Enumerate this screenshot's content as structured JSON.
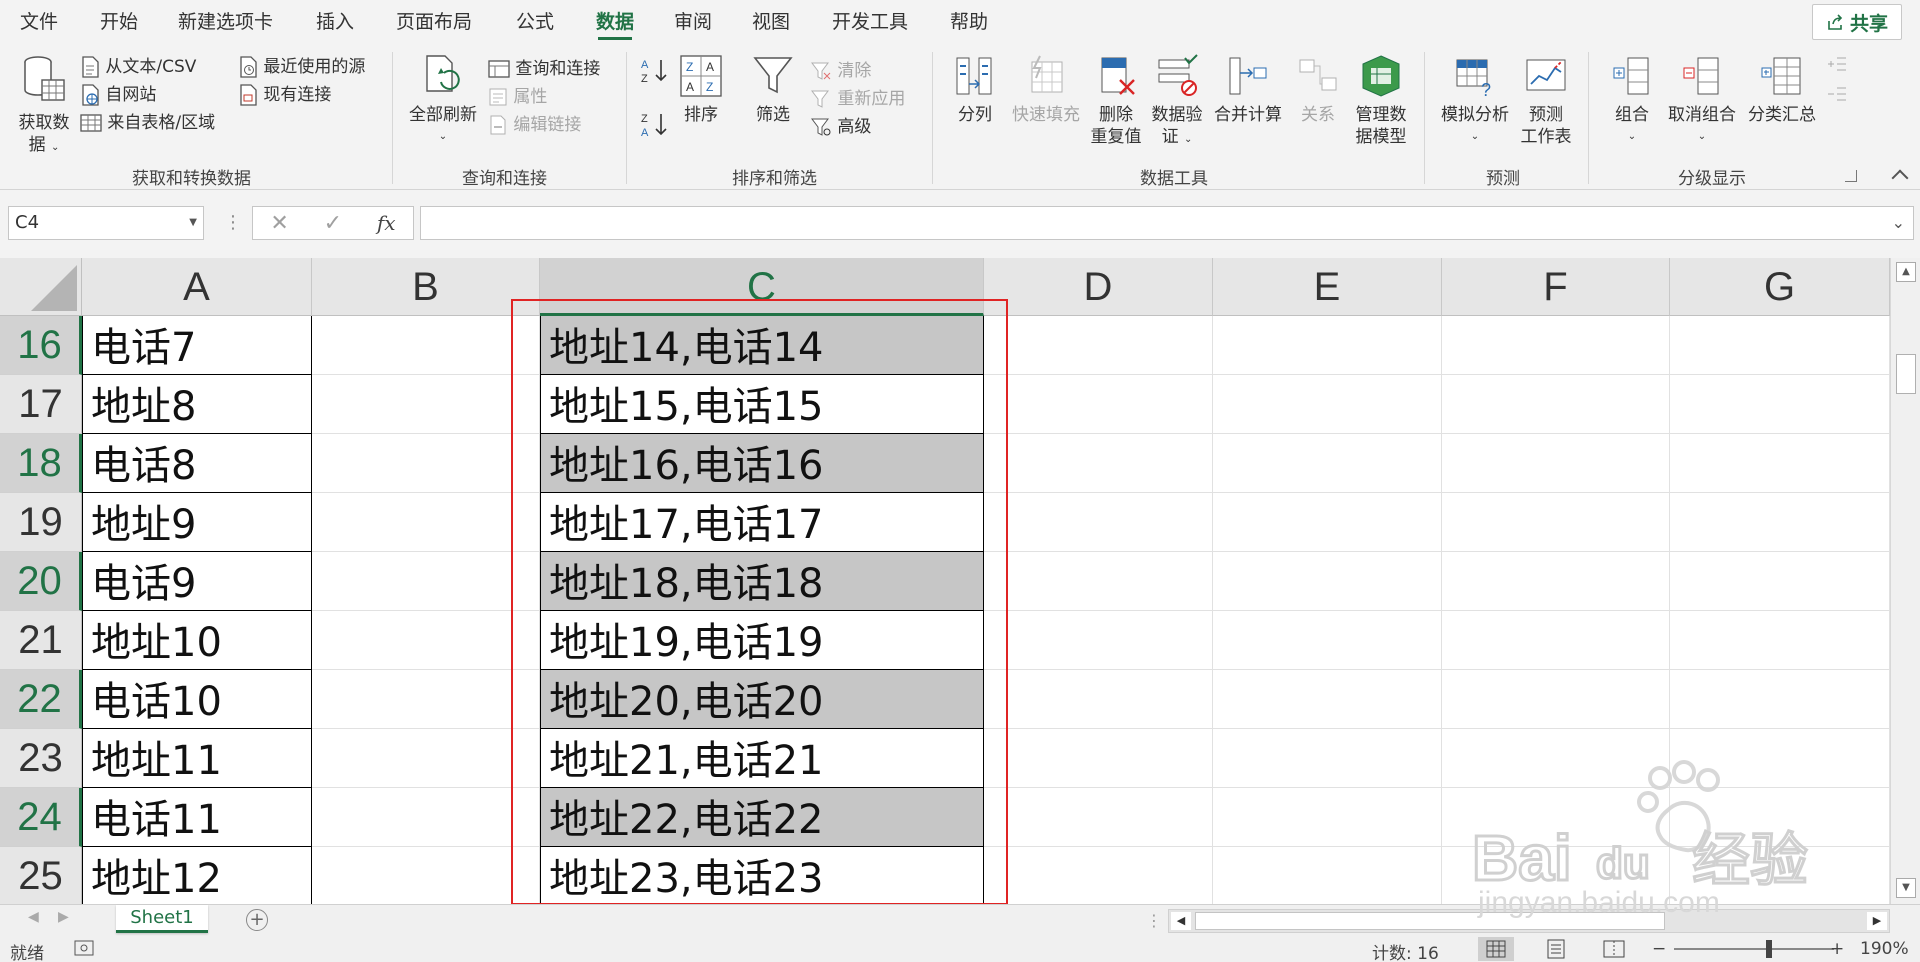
{
  "menu": {
    "tabs": [
      "文件",
      "开始",
      "新建选项卡",
      "插入",
      "页面布局",
      "公式",
      "数据",
      "审阅",
      "视图",
      "开发工具",
      "帮助"
    ],
    "share_label": "共享"
  },
  "ribbon": {
    "get_data": {
      "big_label_1": "获取数",
      "big_label_2": "据",
      "from_text": "从文本/CSV",
      "from_web": "自网站",
      "from_table": "来自表格/区域",
      "recent_sources": "最近使用的源",
      "existing_conn": "现有连接",
      "group": "获取和转换数据"
    },
    "queries": {
      "refresh_all": "全部刷新",
      "queries_conn": "查询和连接",
      "properties": "属性",
      "edit_links": "编辑链接",
      "group": "查询和连接"
    },
    "sort_filter": {
      "sort": "排序",
      "filter": "筛选",
      "clear": "清除",
      "reapply": "重新应用",
      "advanced": "高级",
      "group": "排序和筛选"
    },
    "data_tools": {
      "split": "分列",
      "flash_fill": "快速填充",
      "remove_dup_1": "删除",
      "remove_dup_2": "重复值",
      "validation_1": "数据验",
      "validation_2": "证",
      "consolidate": "合并计算",
      "relationships": "关系",
      "manage_model_1": "管理数",
      "manage_model_2": "据模型",
      "group": "数据工具"
    },
    "forecast": {
      "what_if": "模拟分析",
      "forecast_sheet_1": "预测",
      "forecast_sheet_2": "工作表",
      "group": "预测"
    },
    "outline": {
      "group_btn": "组合",
      "ungroup": "取消组合",
      "subtotal": "分类汇总",
      "group": "分级显示"
    }
  },
  "formula_bar": {
    "name_box": "C4",
    "fx": "fx",
    "value": ""
  },
  "sheet": {
    "columns": [
      "A",
      "B",
      "C",
      "D",
      "E",
      "F",
      "G"
    ],
    "selected_column": "C",
    "rows": [
      {
        "num": "16",
        "a": "电话7",
        "c": "地址14,电话14",
        "shaded": true
      },
      {
        "num": "17",
        "a": "地址8",
        "c": "地址15,电话15",
        "shaded": false
      },
      {
        "num": "18",
        "a": "电话8",
        "c": "地址16,电话16",
        "shaded": true
      },
      {
        "num": "19",
        "a": "地址9",
        "c": "地址17,电话17",
        "shaded": false
      },
      {
        "num": "20",
        "a": "电话9",
        "c": "地址18,电话18",
        "shaded": true
      },
      {
        "num": "21",
        "a": "地址10",
        "c": "地址19,电话19",
        "shaded": false
      },
      {
        "num": "22",
        "a": "电话10",
        "c": "地址20,电话20",
        "shaded": true
      },
      {
        "num": "23",
        "a": "地址11",
        "c": "地址21,电话21",
        "shaded": false
      },
      {
        "num": "24",
        "a": "电话11",
        "c": "地址22,电话22",
        "shaded": true
      },
      {
        "num": "25",
        "a": "地址12",
        "c": "地址23,电话23",
        "shaded": false
      }
    ],
    "highlight_color": "#e02424",
    "accent_color": "#217346"
  },
  "tabs_bar": {
    "sheet_name": "Sheet1",
    "add_symbol": "+"
  },
  "status": {
    "ready": "就绪",
    "count": "计数: 16",
    "zoom": "190%",
    "zoom_minus": "−",
    "zoom_plus": "+"
  }
}
